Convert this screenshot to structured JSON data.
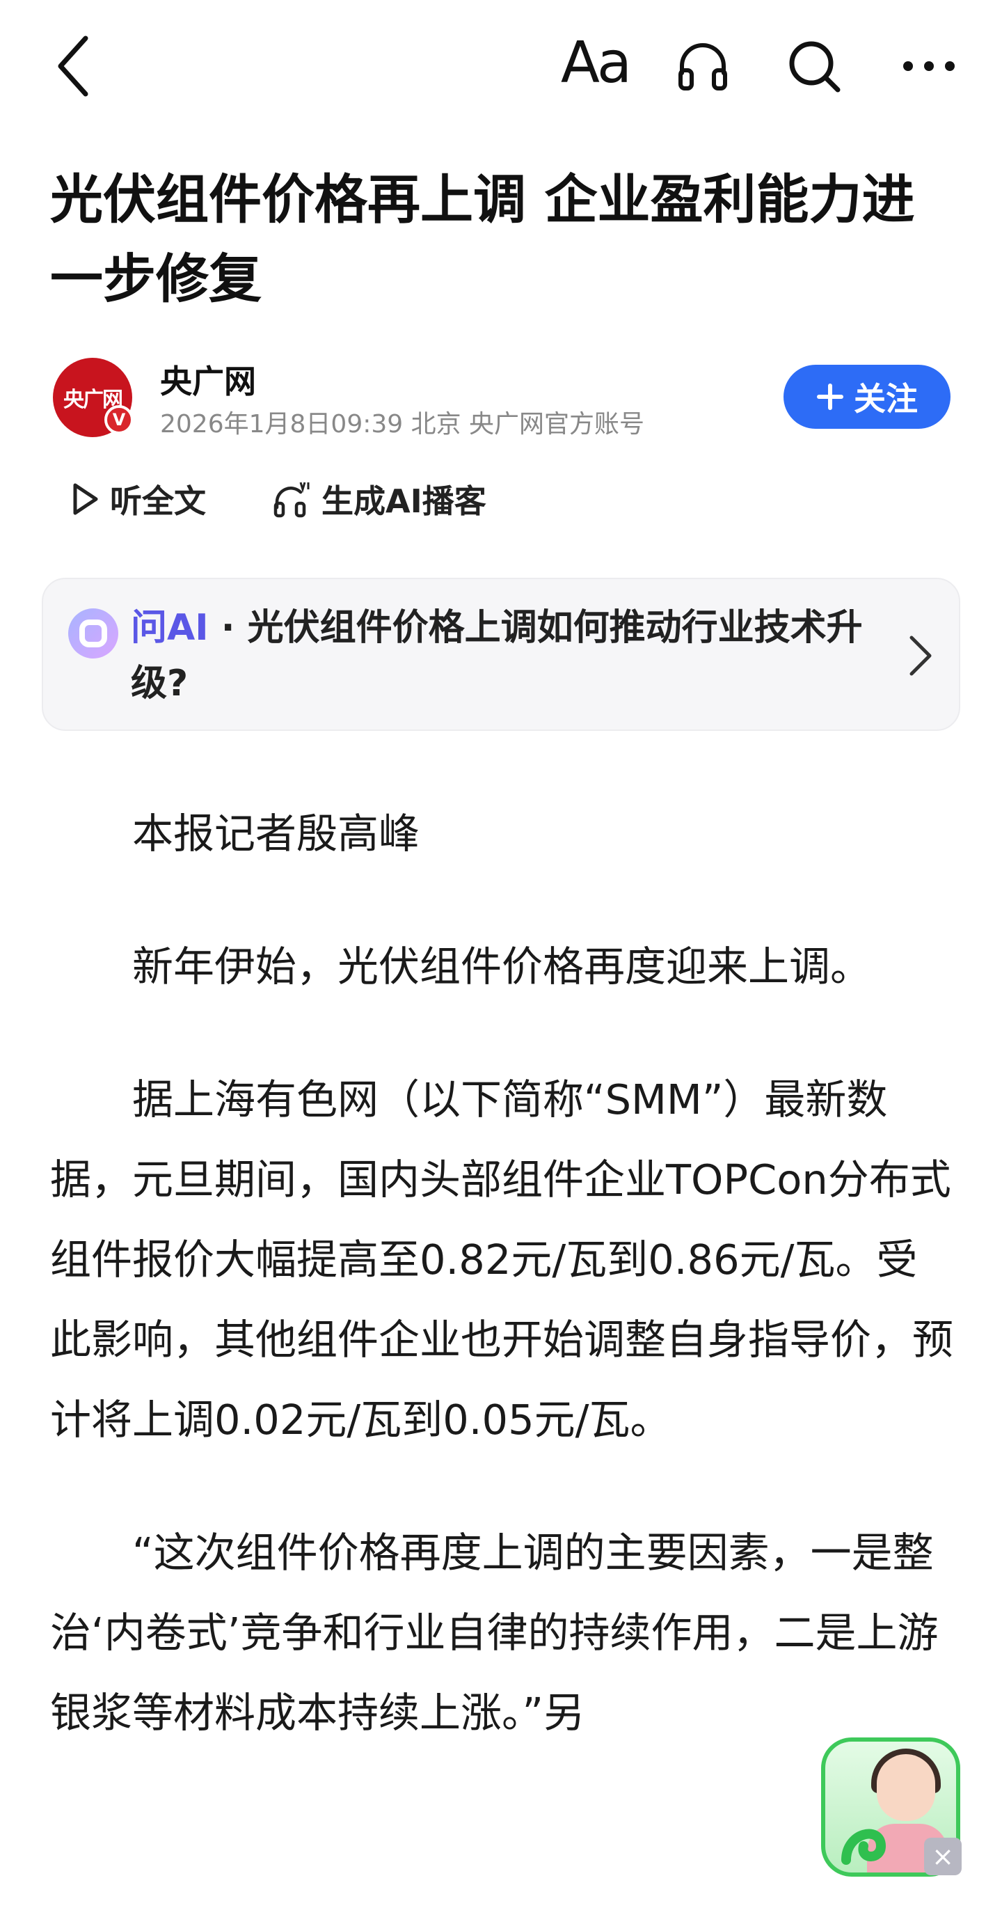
{
  "toolbar": {
    "back_icon": "chevron-left-icon",
    "font_label": "Aa",
    "listen_icon": "headphones-icon",
    "search_icon": "search-icon",
    "more_icon": "more-icon"
  },
  "article": {
    "title": "光伏组件价格再上调 企业盈利能力进一步修复",
    "author": {
      "name": "央广网",
      "avatar_text": "央广网",
      "verified_label": "V",
      "meta": "2026年1月8日09:39 北京 央广网官方账号",
      "follow_label": "关注"
    },
    "actions": {
      "listen_label": "听全文",
      "podcast_label": "生成AI播客"
    },
    "ask_ai": {
      "brand": "问AI",
      "separator": " · ",
      "question": "光伏组件价格上调如何推动行业技术升级?"
    },
    "paragraphs": [
      "本报记者殷高峰",
      "新年伊始，光伏组件价格再度迎来上调。",
      "据上海有色网（以下简称“SMM”）最新数据，元旦期间，国内头部组件企业TOPCon分布式组件报价大幅提高至0.82元/瓦到0.86元/瓦。受此影响，其他组件企业也开始调整自身指导价，预计将上调0.02元/瓦到0.05元/瓦。",
      "“这次组件价格再度上调的主要因素，一是整治‘内卷式’竞争和行业自律的持续作用，二是上游银浆等材料成本持续上涨。”另"
    ]
  },
  "floating_widget": {
    "close_label": "×"
  },
  "colors": {
    "accent": "#2d6cf6",
    "ai_brand": "#5a57e6",
    "brand_red": "#c8141e",
    "widget_green": "#3ec95a"
  }
}
